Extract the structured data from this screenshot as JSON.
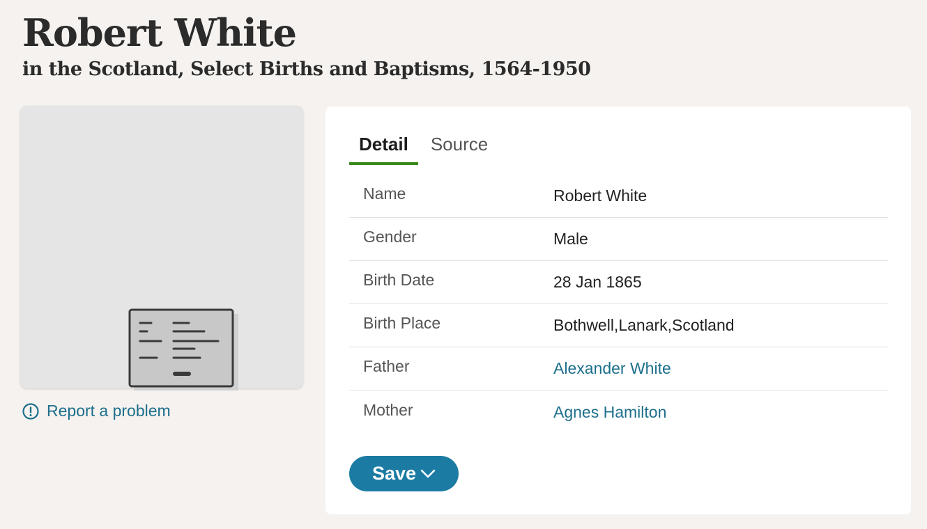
{
  "header": {
    "title": "Robert White",
    "subtitle": "in the Scotland, Select Births and Baptisms, 1564-1950"
  },
  "image_panel": {
    "placeholder_icon": "document-record-icon",
    "report_label": "Report a problem",
    "report_icon": "alert-circle-icon"
  },
  "tabs": [
    {
      "label": "Detail",
      "active": true
    },
    {
      "label": "Source",
      "active": false
    }
  ],
  "details": [
    {
      "label": "Name",
      "value": "Robert White"
    },
    {
      "label": "Gender",
      "value": "Male"
    },
    {
      "label": "Birth Date",
      "value": "28 Jan 1865"
    },
    {
      "label": "Birth Place",
      "value": "Bothwell,Lanark,Scotland"
    },
    {
      "label": "Father",
      "value": "Alexander White"
    },
    {
      "label": "Mother",
      "value": "Agnes Hamilton"
    }
  ],
  "save": {
    "label": "Save",
    "icon": "chevron-down-icon"
  },
  "colors": {
    "background": "#f5f2ef",
    "link": "#1d6f8c",
    "tab_underline": "#3a8a1a",
    "save_button": "#1b7ba3"
  }
}
